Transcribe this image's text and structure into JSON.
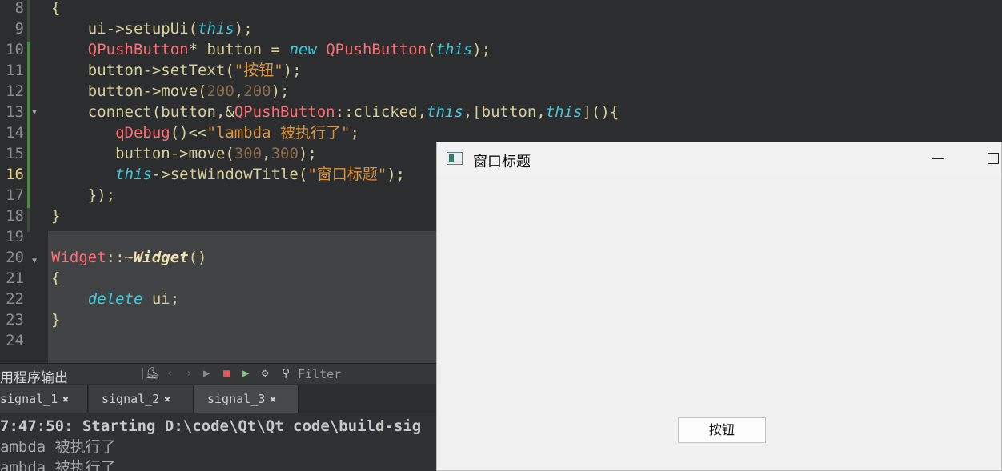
{
  "editor": {
    "current_line": "16",
    "line_numbers": [
      "8",
      "9",
      "10",
      "11",
      "12",
      "13",
      "14",
      "15",
      "16",
      "17",
      "18",
      "19",
      "20",
      "21",
      "22",
      "23",
      "24"
    ],
    "lines": [
      [
        {
          "t": "{",
          "c": "pu"
        }
      ],
      [
        {
          "t": "    ui->setupUi(",
          "c": "pu"
        },
        {
          "t": "this",
          "c": "kw"
        },
        {
          "t": ");",
          "c": "pu"
        }
      ],
      [
        {
          "t": "    ",
          "c": "pu"
        },
        {
          "t": "QPushButton",
          "c": "ty"
        },
        {
          "t": "* button = ",
          "c": "pu"
        },
        {
          "t": "new",
          "c": "kw"
        },
        {
          "t": " ",
          "c": "pu"
        },
        {
          "t": "QPushButton",
          "c": "ty"
        },
        {
          "t": "(",
          "c": "pu"
        },
        {
          "t": "this",
          "c": "kw"
        },
        {
          "t": ");",
          "c": "pu"
        }
      ],
      [
        {
          "t": "    button->setText(",
          "c": "pu"
        },
        {
          "t": "\"按钮\"",
          "c": "str"
        },
        {
          "t": ");",
          "c": "pu"
        }
      ],
      [
        {
          "t": "    button->move(",
          "c": "pu"
        },
        {
          "t": "200",
          "c": "num"
        },
        {
          "t": ",",
          "c": "pu"
        },
        {
          "t": "200",
          "c": "num"
        },
        {
          "t": ");",
          "c": "pu"
        }
      ],
      [
        {
          "t": "    connect(button,&",
          "c": "pu"
        },
        {
          "t": "QPushButton",
          "c": "ty"
        },
        {
          "t": "::clicked,",
          "c": "pu"
        },
        {
          "t": "this",
          "c": "kw"
        },
        {
          "t": ",[button,",
          "c": "pu"
        },
        {
          "t": "this",
          "c": "kw"
        },
        {
          "t": "](){",
          "c": "pu"
        }
      ],
      [
        {
          "t": "       ",
          "c": "pu"
        },
        {
          "t": "qDebug",
          "c": "ty"
        },
        {
          "t": "()<<",
          "c": "pu"
        },
        {
          "t": "\"lambda 被执行了\"",
          "c": "str"
        },
        {
          "t": ";",
          "c": "pu"
        }
      ],
      [
        {
          "t": "       button->move(",
          "c": "pu"
        },
        {
          "t": "300",
          "c": "num"
        },
        {
          "t": ",",
          "c": "pu"
        },
        {
          "t": "300",
          "c": "num"
        },
        {
          "t": ");",
          "c": "pu"
        }
      ],
      [
        {
          "t": "       ",
          "c": "pu"
        },
        {
          "t": "this",
          "c": "kw"
        },
        {
          "t": "->setWindowTitle(",
          "c": "pu"
        },
        {
          "t": "\"窗口标题\"",
          "c": "str"
        },
        {
          "t": ");",
          "c": "pu"
        }
      ],
      [
        {
          "t": "    });",
          "c": "pu"
        }
      ],
      [
        {
          "t": "}",
          "c": "pu"
        }
      ],
      [
        {
          "t": "",
          "c": "pu"
        }
      ],
      [
        {
          "t": "Widget",
          "c": "ty"
        },
        {
          "t": "::~",
          "c": "pu"
        },
        {
          "t": "Widget",
          "c": "fn"
        },
        {
          "t": "()",
          "c": "pu"
        }
      ],
      [
        {
          "t": "{",
          "c": "pu"
        }
      ],
      [
        {
          "t": "    ",
          "c": "pu"
        },
        {
          "t": "delete",
          "c": "kw"
        },
        {
          "t": " ui;",
          "c": "pu"
        }
      ],
      [
        {
          "t": "}",
          "c": "pu"
        }
      ],
      [
        {
          "t": "",
          "c": "pu"
        }
      ]
    ],
    "colors": {
      "type": "#ff6b70",
      "keyword": "#45c6d6",
      "number": "#8a6f4c",
      "string": "#d69545",
      "plain": "#d6cf9a"
    }
  },
  "output": {
    "title": "用程序输出",
    "filter_placeholder": "Filter",
    "tabs": [
      {
        "label": "signal_1"
      },
      {
        "label": "signal_2"
      },
      {
        "label": "signal_3"
      }
    ],
    "lines": [
      "7:47:50: Starting D:\\code\\Qt\\Qt code\\build-sig",
      "ambda 被执行了",
      "ambda 被执行了"
    ]
  },
  "window": {
    "title": "窗口标题",
    "button_label": "按钮"
  }
}
